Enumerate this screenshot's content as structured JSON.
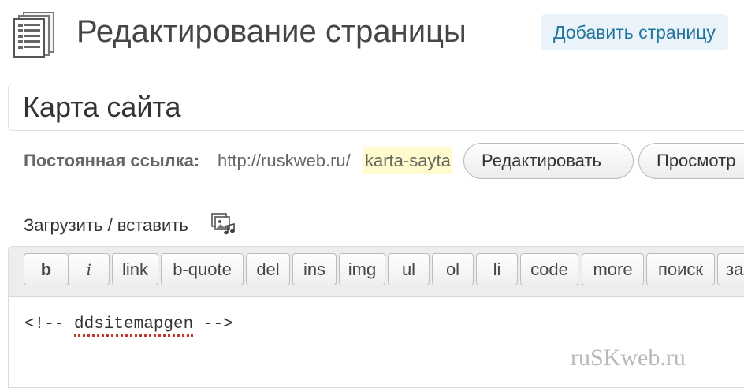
{
  "header": {
    "title": "Редактирование страницы",
    "add_button_label": "Добавить страницу"
  },
  "post": {
    "title_value": "Карта сайта"
  },
  "permalink": {
    "label": "Постоянная ссылка:",
    "base_url": "http://ruskweb.ru/",
    "slug": "karta-sayta",
    "edit_label": "Редактировать",
    "view_label": "Просмотр"
  },
  "media": {
    "label": "Загрузить / вставить",
    "icon": "media-upload-icon"
  },
  "quicktags": [
    "b",
    "i",
    "link",
    "b-quote",
    "del",
    "ins",
    "img",
    "ul",
    "ol",
    "li",
    "code",
    "more",
    "поиск",
    "за"
  ],
  "content": {
    "open": "<!-- ",
    "word": "ddsitemapgen",
    "close": " -->"
  },
  "watermark": "ruSKweb.ru",
  "colors": {
    "accent": "#21759b",
    "slug_highlight": "#fffbcc",
    "spell_underline": "#c0392b"
  }
}
